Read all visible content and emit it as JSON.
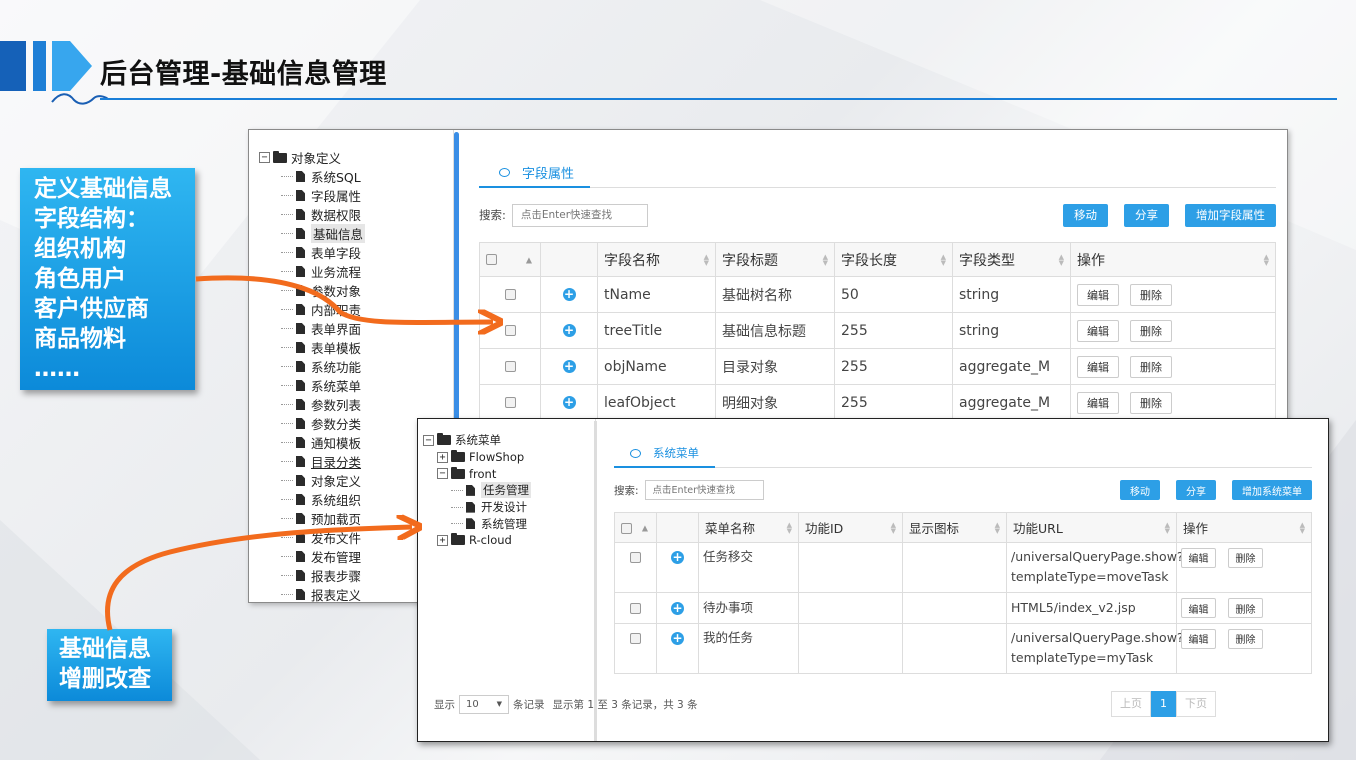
{
  "header": {
    "title": "后台管理-基础信息管理"
  },
  "callouts": {
    "structure_lines": [
      "定义基础信息",
      "字段结构：",
      "组织机构",
      "角色用户",
      "客户供应商",
      "商品物料",
      "……"
    ],
    "crud_lines": [
      "基础信息",
      "增删改查"
    ]
  },
  "colors": {
    "accent": "#2d9fe6",
    "title_line": "#1a7fd8",
    "arrow": "#f26b1d",
    "callout": "#0c8ad9"
  },
  "panel1": {
    "tree": [
      {
        "label": "对象定义",
        "type": "folder",
        "toggle": "−",
        "level": 0
      },
      {
        "label": "系统SQL",
        "type": "file",
        "level": 1
      },
      {
        "label": "字段属性",
        "type": "file",
        "level": 1
      },
      {
        "label": "数据权限",
        "type": "file",
        "level": 1
      },
      {
        "label": "基础信息",
        "type": "file",
        "level": 1,
        "selected": true
      },
      {
        "label": "表单字段",
        "type": "file",
        "level": 1
      },
      {
        "label": "业务流程",
        "type": "file",
        "level": 1
      },
      {
        "label": "参数对象",
        "type": "file",
        "level": 1
      },
      {
        "label": "内部职责",
        "type": "file",
        "level": 1
      },
      {
        "label": "表单界面",
        "type": "file",
        "level": 1
      },
      {
        "label": "表单模板",
        "type": "file",
        "level": 1
      },
      {
        "label": "系统功能",
        "type": "file",
        "level": 1
      },
      {
        "label": "系统菜单",
        "type": "file",
        "level": 1
      },
      {
        "label": "参数列表",
        "type": "file",
        "level": 1
      },
      {
        "label": "参数分类",
        "type": "file",
        "level": 1
      },
      {
        "label": "通知模板",
        "type": "file",
        "level": 1
      },
      {
        "label": "目录分类",
        "type": "file",
        "level": 1,
        "underline": true
      },
      {
        "label": "对象定义",
        "type": "file",
        "level": 1
      },
      {
        "label": "系统组织",
        "type": "file",
        "level": 1
      },
      {
        "label": "预加载页",
        "type": "file",
        "level": 1
      },
      {
        "label": "发布文件",
        "type": "file",
        "level": 1
      },
      {
        "label": "发布管理",
        "type": "file",
        "level": 1
      },
      {
        "label": "报表步骤",
        "type": "file",
        "level": 1
      },
      {
        "label": "报表定义",
        "type": "file",
        "level": 1
      }
    ],
    "tab": "字段属性",
    "search_label": "搜索:",
    "search_placeholder": "点击Enter快速查找",
    "buttons": [
      "移动",
      "分享",
      "增加字段属性"
    ],
    "columns": [
      "字段名称",
      "字段标题",
      "字段长度",
      "字段类型",
      "操作"
    ],
    "rows": [
      {
        "name": "tName",
        "title": "基础树名称",
        "length": "50",
        "type": "string"
      },
      {
        "name": "treeTitle",
        "title": "基础信息标题",
        "length": "255",
        "type": "string"
      },
      {
        "name": "objName",
        "title": "目录对象",
        "length": "255",
        "type": "aggregate_M"
      },
      {
        "name": "leafObject",
        "title": "明细对象",
        "length": "255",
        "type": "aggregate_M"
      }
    ],
    "edit_label": "编辑",
    "delete_label": "删除"
  },
  "panel2": {
    "tree": [
      {
        "label": "系统菜单",
        "type": "folder",
        "toggle": "−",
        "level": 0
      },
      {
        "label": "FlowShop",
        "type": "folder",
        "toggle": "+",
        "level": 1
      },
      {
        "label": "front",
        "type": "folder",
        "toggle": "−",
        "level": 1
      },
      {
        "label": "任务管理",
        "type": "file",
        "level": 2,
        "selected": true
      },
      {
        "label": "开发设计",
        "type": "file",
        "level": 2
      },
      {
        "label": "系统管理",
        "type": "file",
        "level": 2
      },
      {
        "label": "R-cloud",
        "type": "folder",
        "toggle": "+",
        "level": 1
      }
    ],
    "tab": "系统菜单",
    "search_label": "搜索:",
    "search_placeholder": "点击Enter快速查找",
    "buttons": [
      "移动",
      "分享",
      "增加系统菜单"
    ],
    "columns": [
      "菜单名称",
      "功能ID",
      "显示图标",
      "功能URL",
      "操作"
    ],
    "rows": [
      {
        "name": "任务移交",
        "func_id": "",
        "icon": "",
        "url_lines": [
          "/universalQueryPage.show?",
          "templateType=moveTask"
        ]
      },
      {
        "name": "待办事项",
        "func_id": "",
        "icon": "",
        "url_lines": [
          "HTML5/index_v2.jsp"
        ]
      },
      {
        "name": "我的任务",
        "func_id": "",
        "icon": "",
        "url_lines": [
          "/universalQueryPage.show?",
          "templateType=myTask"
        ]
      }
    ],
    "edit_label": "编辑",
    "delete_label": "删除",
    "pager": {
      "show_label": "显示",
      "page_size": "10",
      "records_label": "条记录",
      "summary": "显示第 1 至 3 条记录，共 3 条",
      "prev": "上页",
      "current": "1",
      "next": "下页"
    }
  }
}
